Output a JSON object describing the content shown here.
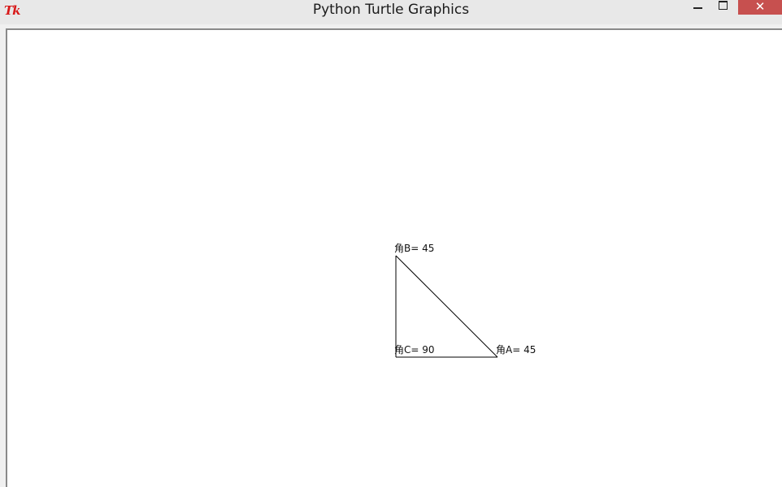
{
  "window": {
    "title": "Python Turtle Graphics",
    "app_icon_text": "Tk",
    "app_icon_color": "#d81818",
    "close_button_color": "#c7504f"
  },
  "title_controls": {
    "minimize_icon": "minimize-icon",
    "maximize_icon": "maximize-icon",
    "close_icon": "close-icon",
    "close_glyph": "✕"
  },
  "canvas": {
    "background": "#ffffff",
    "line_color": "#000000",
    "labels": {
      "angle_b": "角B= 45",
      "angle_c": "角C= 90",
      "angle_a": "角A= 45"
    }
  }
}
